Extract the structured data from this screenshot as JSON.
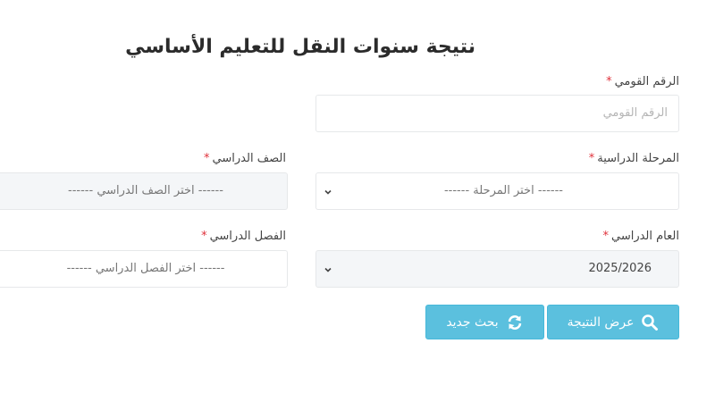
{
  "page": {
    "title": "نتيجة سنوات النقل للتعليم الأساسي"
  },
  "form": {
    "national_id": {
      "label": "الرقم القومي",
      "required_mark": "*",
      "placeholder": "الرقم القومي"
    },
    "stage": {
      "label": "المرحلة الدراسية",
      "required_mark": "*",
      "selected": "------ اختر المرحلة ------"
    },
    "grade": {
      "label": "الصف الدراسي",
      "required_mark": "*",
      "selected": "------ اختر الصف الدراسي ------"
    },
    "academic_year": {
      "label": "العام الدراسي",
      "required_mark": "*",
      "selected": "2025/2026"
    },
    "term": {
      "label": "الفصل الدراسي",
      "required_mark": "*",
      "selected": "------ اختر الفصل الدراسي ------"
    }
  },
  "buttons": {
    "show_result": {
      "label": "عرض النتيجة",
      "icon": "search-icon"
    },
    "new_search": {
      "label": "بحث جديد",
      "icon": "refresh-icon"
    }
  },
  "colors": {
    "button_bg": "#5bc0de",
    "required": "#e0313b",
    "select_bg": "#f4f6f8"
  }
}
